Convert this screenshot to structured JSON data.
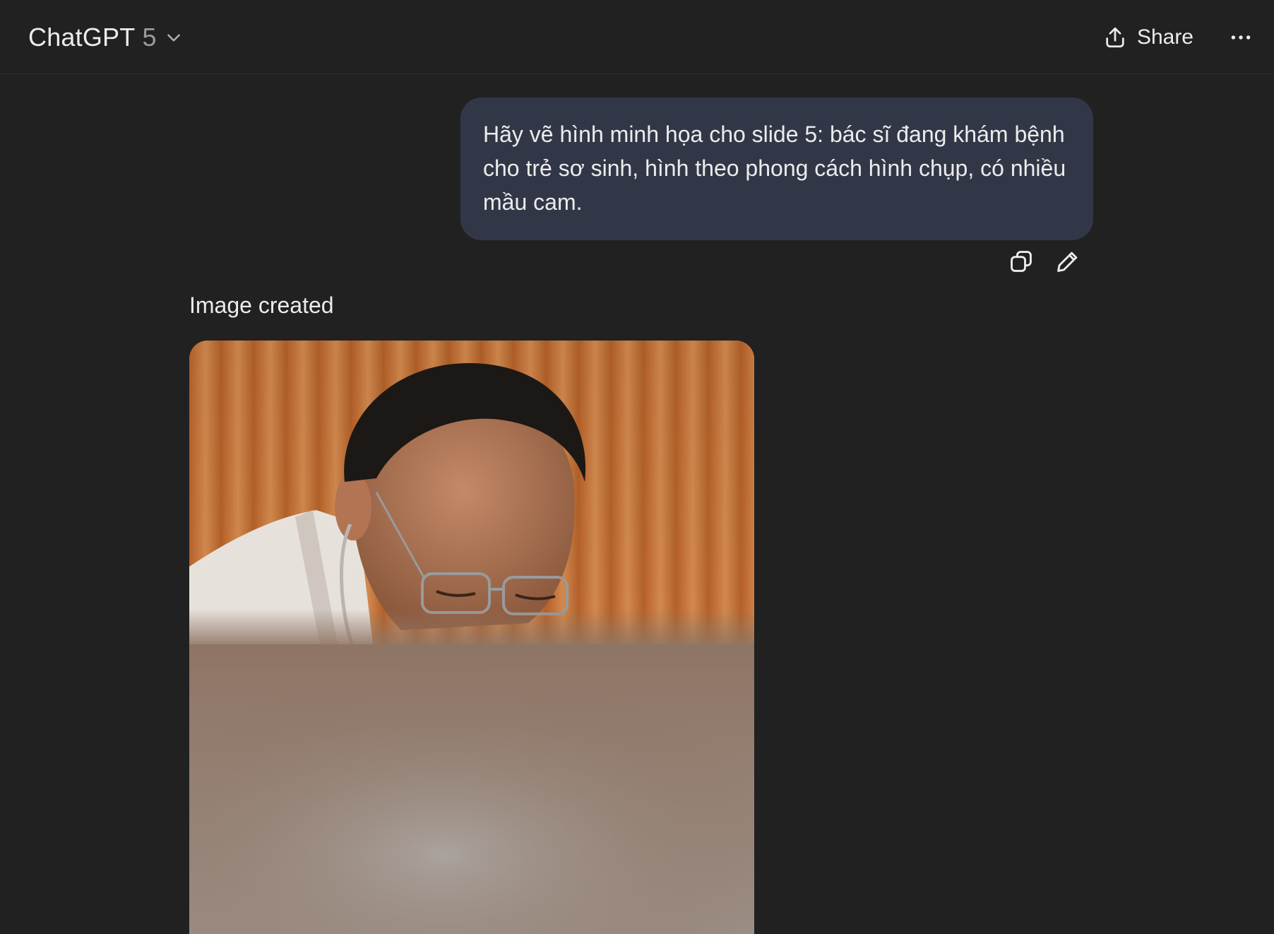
{
  "header": {
    "model_name": "ChatGPT",
    "model_version": "5",
    "share_label": "Share"
  },
  "conversation": {
    "user_message": "Hãy vẽ hình minh họa cho slide 5: bác sĩ đang khám bệnh cho trẻ sơ sinh, hình theo phong cách hình chụp, có nhiều mầu cam.",
    "assistant_status": "Image created"
  },
  "icons": {
    "model_dropdown": "chevron-down-icon",
    "share": "share-upload-icon",
    "more": "more-horizontal-icon",
    "copy": "copy-icon",
    "edit": "edit-pencil-icon"
  },
  "colors": {
    "background": "#212121",
    "user_bubble": "#323748",
    "text": "#ececec",
    "muted_text": "#9b9b9b",
    "image_accent": "#c9773a"
  }
}
